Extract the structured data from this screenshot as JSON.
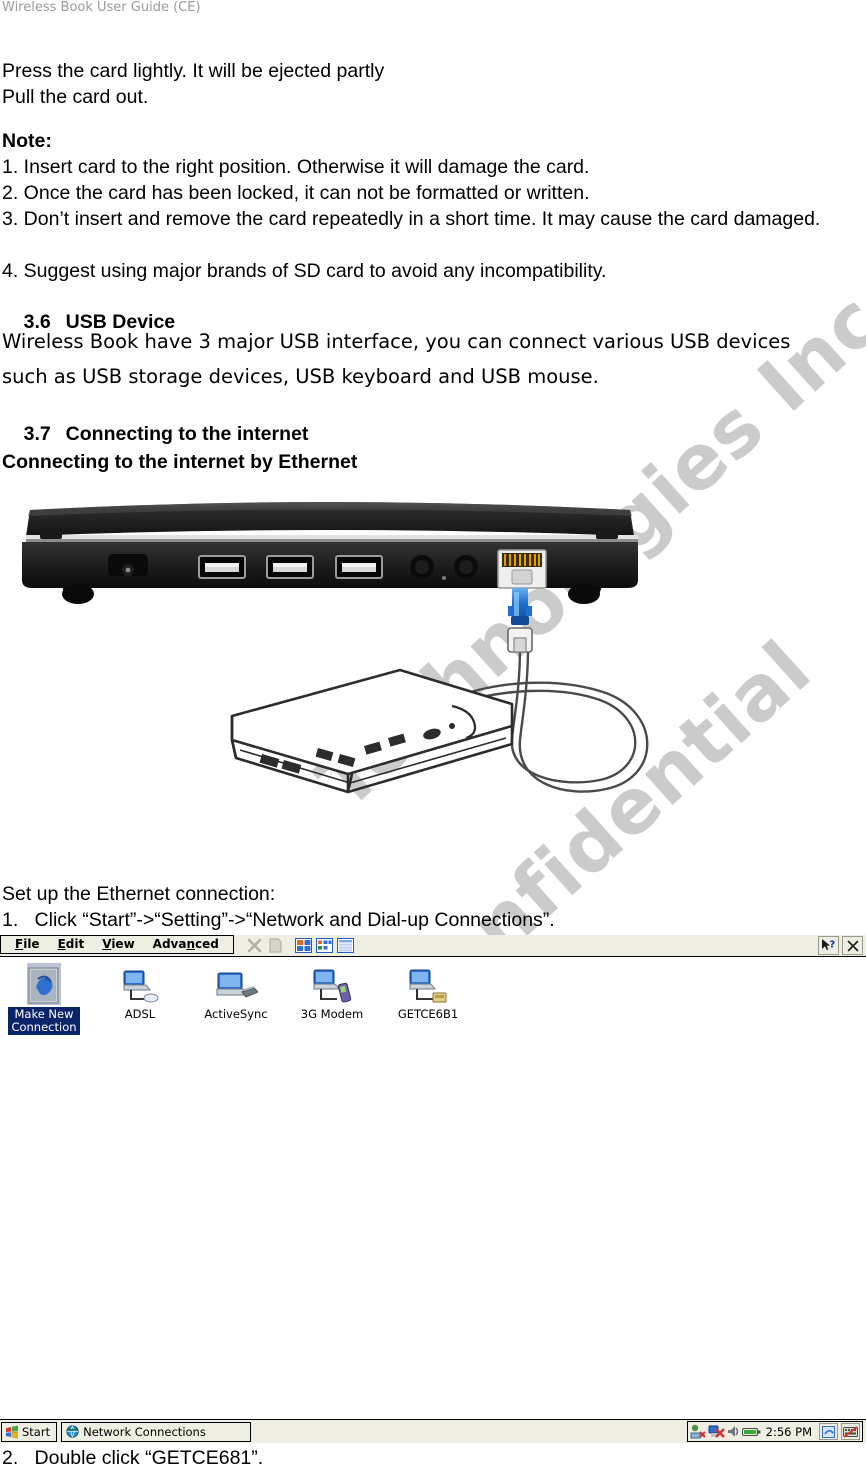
{
  "header": {
    "running_title": "Wireless Book User Guide (CE)"
  },
  "watermark": {
    "line1": "Technologies Inc.",
    "line2": "Confidential",
    "color": "#c9c9c9"
  },
  "doc": {
    "intro_line1": "Press the card lightly. It will be ejected partly",
    "intro_line2": "Pull the card out.",
    "note_label": "Note:",
    "notes": [
      "1. Insert card to the right position. Otherwise it will damage the card.",
      "2. Once the card has been locked, it can not be formatted or written.",
      "3. Don’t insert and remove the card repeatedly in a short time. It may cause the card damaged.",
      "4. Suggest using major brands of SD card to avoid any incompatibility."
    ],
    "section_36_num": "3.6",
    "section_36_title": "USB Device",
    "usb_para_line1": "Wireless Book have 3 major USB interface, you can connect various USB devices",
    "usb_para_line2": "such as USB storage devices, USB keyboard and USB mouse.",
    "section_37_num": "3.7",
    "section_37_title": "Connecting to the internet",
    "subheading_ethernet": "Connecting to the internet by Ethernet",
    "setup_line": "Set up the Ethernet connection:",
    "step1_num": "1.",
    "step1_text": "Click “Start”->“Setting”->“Network and Dial-up Connections”.",
    "step2_num": "2.",
    "step2_text": "Double click “GETCE681”."
  },
  "illustration": {
    "alt_laptop": "laptop-rear-ports",
    "alt_router": "ethernet-router-with-cable",
    "cable_connector_color": "#1f6fd0"
  },
  "ce_window": {
    "title": "Network Connections",
    "menus": [
      {
        "label": "File",
        "accel": "F"
      },
      {
        "label": "Edit",
        "accel": "E"
      },
      {
        "label": "View",
        "accel": "V"
      },
      {
        "label": "Advanced",
        "accel": "n"
      }
    ],
    "toolbar_buttons": [
      {
        "name": "delete-button",
        "icon": "x-icon",
        "enabled": false
      },
      {
        "name": "properties-button",
        "icon": "page-icon",
        "enabled": false
      },
      {
        "name": "large-icons-view-button",
        "icon": "large-icons-icon",
        "enabled": true
      },
      {
        "name": "small-icons-view-button",
        "icon": "small-icons-icon",
        "enabled": true
      },
      {
        "name": "details-view-button",
        "icon": "details-icon",
        "enabled": true
      }
    ],
    "right_buttons": [
      {
        "name": "help-button",
        "icon": "help-pointer-icon"
      },
      {
        "name": "close-button",
        "icon": "close-icon"
      }
    ],
    "connections": [
      {
        "label": "Make New Connection",
        "icon": "new-connection-icon",
        "selected": true
      },
      {
        "label": "ADSL",
        "icon": "dialup-connection-icon",
        "selected": false
      },
      {
        "label": "ActiveSync",
        "icon": "activesync-icon",
        "selected": false
      },
      {
        "label": "3G Modem",
        "icon": "modem-connection-icon",
        "selected": false
      },
      {
        "label": "GETCE6B1",
        "icon": "lan-connection-icon",
        "selected": false
      }
    ]
  },
  "taskbar": {
    "start_label": "Start",
    "task_label": "Network Connections",
    "clock": "2:56 PM",
    "tray_icons": [
      "network-error-icon",
      "connection-error-icon",
      "volume-icon",
      "battery-icon"
    ],
    "tray_buttons": [
      "desktop-icon",
      "keyboard-disabled-icon"
    ]
  },
  "colors": {
    "taskbar_bg": "#efeee2",
    "selection_blue": "#0a246a",
    "header_grey": "#9b9b9b"
  }
}
